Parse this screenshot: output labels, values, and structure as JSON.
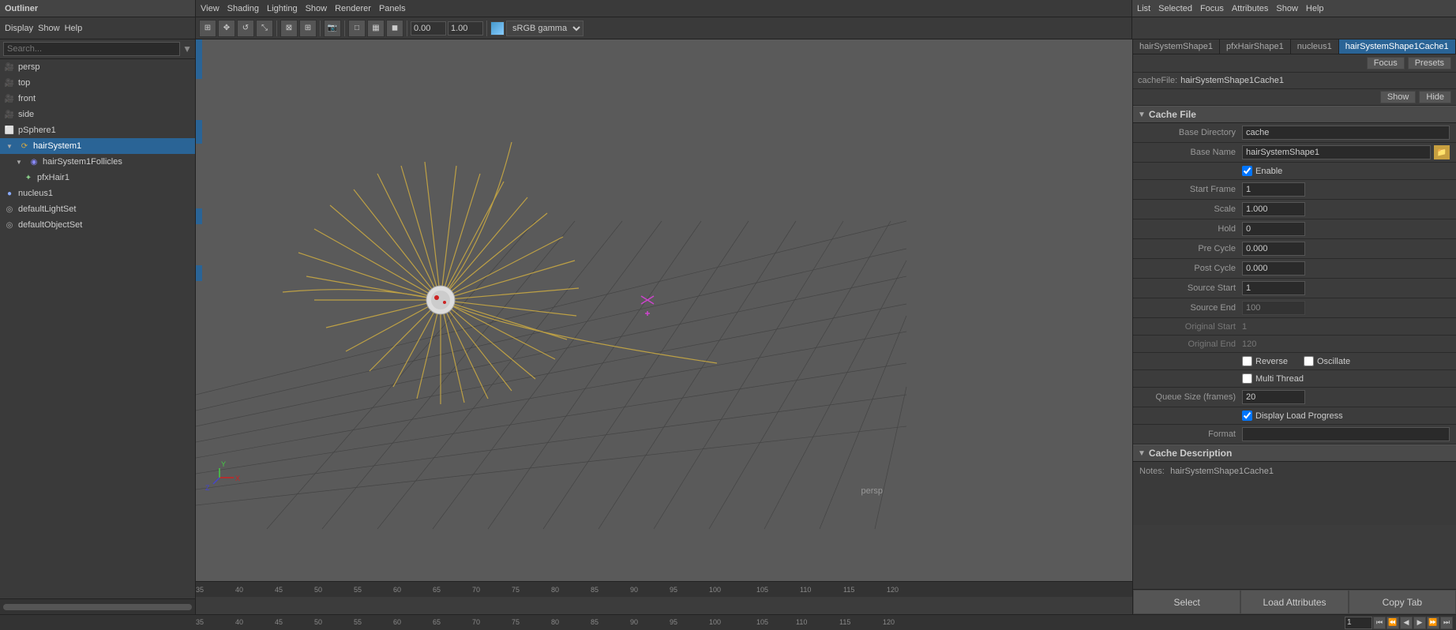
{
  "outliner": {
    "title": "Outliner",
    "menubar": [
      "Display",
      "Show",
      "Help"
    ],
    "search_placeholder": "Search...",
    "items": [
      {
        "label": "persp",
        "type": "camera",
        "indent": 0
      },
      {
        "label": "top",
        "type": "camera",
        "indent": 0
      },
      {
        "label": "front",
        "type": "camera",
        "indent": 0
      },
      {
        "label": "side",
        "type": "camera",
        "indent": 0
      },
      {
        "label": "pSphere1",
        "type": "mesh",
        "indent": 0
      },
      {
        "label": "hairSystem1",
        "type": "hair",
        "indent": 0,
        "selected": true
      },
      {
        "label": "hairSystem1Follicles",
        "type": "follicle",
        "indent": 1
      },
      {
        "label": "pfxHair1",
        "type": "particles",
        "indent": 2
      },
      {
        "label": "nucleus1",
        "type": "nucleus",
        "indent": 0
      },
      {
        "label": "defaultLightSet",
        "type": "set",
        "indent": 0
      },
      {
        "label": "defaultObjectSet",
        "type": "set",
        "indent": 0
      }
    ]
  },
  "viewport": {
    "menubar": [
      "View",
      "Shading",
      "Lighting",
      "Show",
      "Renderer",
      "Panels"
    ],
    "label": "persp",
    "axes_label": "xyz"
  },
  "attributes": {
    "top_menubar": [
      "List",
      "Selected",
      "Focus",
      "Attributes",
      "Show",
      "Help"
    ],
    "tabs": [
      {
        "label": "hairSystemShape1",
        "active": false
      },
      {
        "label": "pfxHairShape1",
        "active": false
      },
      {
        "label": "nucleus1",
        "active": false
      },
      {
        "label": "hairSystemShape1Cache1",
        "active": true
      }
    ],
    "focus_btn": "Focus",
    "presets_btn": "Presets",
    "show_btn": "Show",
    "hide_btn": "Hide",
    "cache_file_label": "cacheFile:",
    "cache_file_value": "hairSystemShape1Cache1",
    "sections": {
      "cache_file": {
        "title": "Cache File",
        "base_directory_label": "Base Directory",
        "base_directory_value": "cache",
        "base_name_label": "Base Name",
        "base_name_value": "hairSystemShape1",
        "enable_label": "Enable",
        "enable_checked": true,
        "start_frame_label": "Start Frame",
        "start_frame_value": "1",
        "scale_label": "Scale",
        "scale_value": "1.000",
        "hold_label": "Hold",
        "hold_value": "0",
        "pre_cycle_label": "Pre Cycle",
        "pre_cycle_value": "0.000",
        "post_cycle_label": "Post Cycle",
        "post_cycle_value": "0.000",
        "source_start_label": "Source Start",
        "source_start_value": "1",
        "source_end_label": "Source End",
        "source_end_value": "100",
        "original_start_label": "Original Start",
        "original_start_value": "1",
        "original_end_label": "Original End",
        "original_end_value": "120",
        "reverse_label": "Reverse",
        "reverse_checked": false,
        "oscillate_label": "Oscillate",
        "oscillate_checked": false,
        "multi_thread_label": "Multi Thread",
        "multi_thread_checked": false,
        "queue_size_label": "Queue Size (frames)",
        "queue_size_value": "20",
        "display_load_progress_label": "Display Load Progress",
        "display_load_progress_checked": true,
        "format_label": "Format",
        "format_value": ""
      },
      "cache_description": {
        "title": "Cache Description",
        "notes_label": "Notes:",
        "notes_value": "hairSystemShape1Cache1"
      }
    }
  },
  "bottom_buttons": {
    "select": "Select",
    "load_attributes": "Load Attributes",
    "copy_tab": "Copy Tab"
  },
  "timeline": {
    "ticks": [
      "35",
      "40",
      "45",
      "50",
      "55",
      "60",
      "65",
      "70",
      "75",
      "80",
      "85",
      "90",
      "95",
      "100",
      "105",
      "110",
      "115",
      "120"
    ],
    "frame_value": "1",
    "playback_controls": [
      "⏮",
      "⏪",
      "◀",
      "▶",
      "⏩",
      "⏭"
    ]
  },
  "global_timeline": {
    "ticks": [
      "35",
      "40",
      "45",
      "50",
      "55",
      "60",
      "65",
      "70",
      "75",
      "80",
      "85",
      "90",
      "95",
      "100",
      "105",
      "110",
      "115",
      "120"
    ],
    "frame_input": "1"
  }
}
